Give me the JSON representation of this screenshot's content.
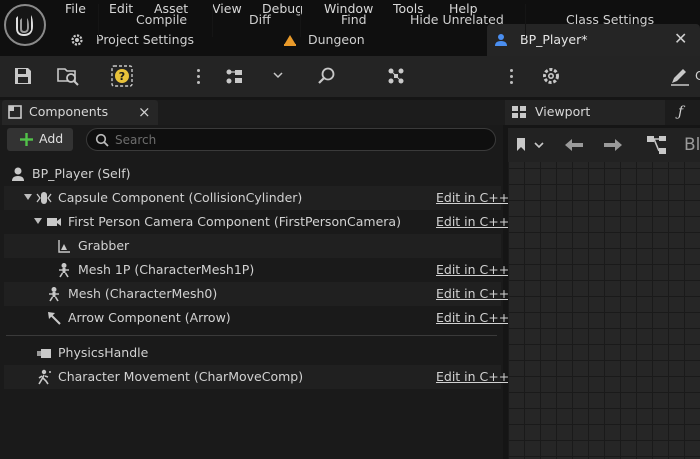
{
  "menu": [
    "File",
    "Edit",
    "Asset",
    "View",
    "Debug",
    "Window",
    "Tools",
    "Help"
  ],
  "tabs": [
    {
      "label": "Project Settings",
      "icon": "gear-icon"
    },
    {
      "label": "Dungeon",
      "icon": "level-icon"
    },
    {
      "label": "BP_Player*",
      "icon": "blueprint-person-icon"
    }
  ],
  "toolbar": {
    "compile": "Compile",
    "diff": "Diff",
    "find": "Find",
    "hide_unrelated": "Hide Unrelated",
    "class_settings": "Class Settings"
  },
  "components_panel": {
    "title": "Components",
    "close": "×",
    "add": "Add",
    "search_placeholder": "Search",
    "tree": [
      {
        "label": "BP_Player (Self)",
        "edit": ""
      },
      {
        "label": "Capsule Component (CollisionCylinder)",
        "edit": "Edit in C++"
      },
      {
        "label": "First Person Camera Component (FirstPersonCamera)",
        "edit": "Edit in C++"
      },
      {
        "label": "Grabber",
        "edit": ""
      },
      {
        "label": "Mesh 1P (CharacterMesh1P)",
        "edit": "Edit in C++"
      },
      {
        "label": "Mesh (CharacterMesh0)",
        "edit": "Edit in C++"
      },
      {
        "label": "Arrow Component (Arrow)",
        "edit": "Edit in C++"
      },
      {
        "label": "PhysicsHandle",
        "edit": ""
      },
      {
        "label": "Character Movement (CharMoveComp)",
        "edit": "Edit in C++"
      }
    ]
  },
  "viewport_panel": {
    "title": "Viewport",
    "partial_label": "Bl"
  },
  "colors": {
    "accent_blue": "#4a8ef0",
    "compile_warning": "#e8c23a",
    "add_green": "#52c24a",
    "dungeon_orange": "#e89a2a"
  }
}
